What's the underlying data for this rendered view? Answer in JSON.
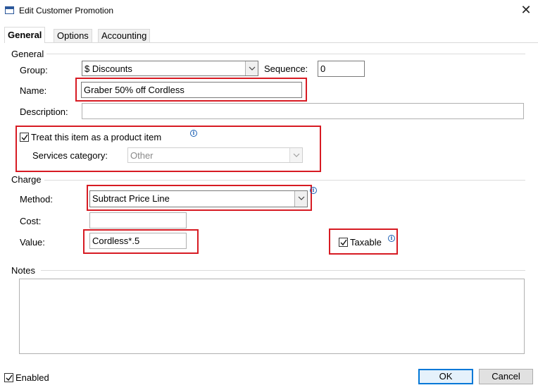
{
  "window": {
    "title": "Edit Customer Promotion",
    "close_glyph": "✕"
  },
  "tabs": [
    {
      "label": "General",
      "active": true
    },
    {
      "label": "Options",
      "active": false
    },
    {
      "label": "Accounting",
      "active": false
    }
  ],
  "general_section": {
    "heading": "General",
    "group_label": "Group:",
    "group_value": "$ Discounts",
    "sequence_label": "Sequence:",
    "sequence_value": "0",
    "name_label": "Name:",
    "name_value": "Graber 50% off Cordless",
    "description_label": "Description:",
    "description_value": "",
    "product_item_label": "Treat this item as a product item",
    "product_item_checked": true,
    "services_category_label": "Services category:",
    "services_category_value": "Other"
  },
  "charge_section": {
    "heading": "Charge",
    "method_label": "Method:",
    "method_value": "Subtract Price Line",
    "cost_label": "Cost:",
    "cost_value": "",
    "value_label": "Value:",
    "value_value": "Cordless*.5",
    "taxable_label": "Taxable",
    "taxable_checked": true
  },
  "notes_section": {
    "heading": "Notes",
    "value": ""
  },
  "footer": {
    "enabled_label": "Enabled",
    "enabled_checked": true,
    "ok_label": "OK",
    "cancel_label": "Cancel"
  },
  "colors": {
    "highlight": "#d71b23",
    "info_icon": "#1a5fb4",
    "ok_border": "#0078d7"
  }
}
